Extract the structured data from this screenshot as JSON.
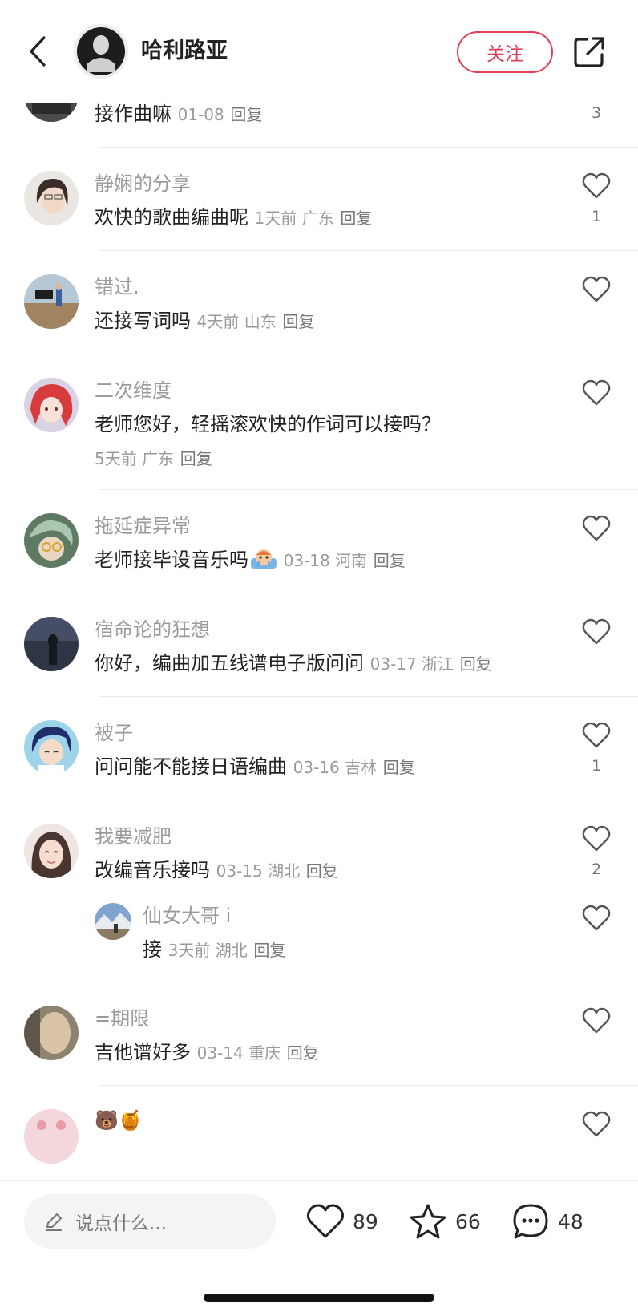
{
  "header": {
    "author_name": "哈利路亚",
    "follow_label": "关注"
  },
  "comments": [
    {
      "name": "",
      "text": "接作曲嘛",
      "meta": "01-08",
      "reply": "回复",
      "likes": "3"
    },
    {
      "name": "静娴的分享",
      "text": "欢快的歌曲编曲呢",
      "meta": "1天前 广东",
      "reply": "回复",
      "likes": "1"
    },
    {
      "name": "错过.",
      "text": "还接写词吗",
      "meta": "4天前 山东",
      "reply": "回复",
      "likes": ""
    },
    {
      "name": "二次维度",
      "text": "老师您好，轻摇滚欢快的作词可以接吗？",
      "meta": "5天前 广东",
      "reply": "回复",
      "likes": ""
    },
    {
      "name": "拖延症异常",
      "text": "老师接毕设音乐吗",
      "meta": "03-18 河南",
      "reply": "回复",
      "likes": ""
    },
    {
      "name": "宿命论的狂想",
      "text": "你好，编曲加五线谱电子版问问",
      "meta": "03-17 浙江",
      "reply": "回复",
      "likes": ""
    },
    {
      "name": "被子",
      "text": "问问能不能接日语编曲",
      "meta": "03-16 吉林",
      "reply": "回复",
      "likes": "1"
    },
    {
      "name": "我要减肥",
      "text": "改编音乐接吗",
      "meta": "03-15 湖北",
      "reply": "回复",
      "likes": "2"
    },
    {
      "name": "仙女大哥 i",
      "text": "接",
      "meta": "3天前 湖北",
      "reply": "回复",
      "likes": ""
    },
    {
      "name": "=期限",
      "text": "吉他谱好多",
      "meta": "03-14 重庆",
      "reply": "回复",
      "likes": ""
    },
    {
      "name": "",
      "text": "🐻🍯",
      "meta": "",
      "reply": "",
      "likes": ""
    }
  ],
  "bottom": {
    "input_placeholder": "说点什么...",
    "likes_count": "89",
    "favorites_count": "66",
    "comments_count": "48"
  },
  "colors": {
    "accent": "#e23b54",
    "muted_text": "#9a9a9a",
    "divider": "#ececec"
  }
}
